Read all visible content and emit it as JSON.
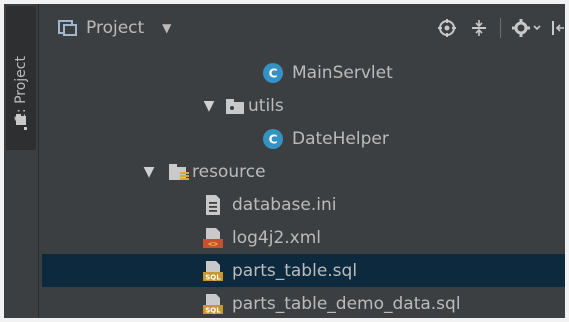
{
  "sidebar": {
    "tab_label": "1: Project"
  },
  "header": {
    "title": "Project",
    "actions": [
      "locate-icon",
      "collapse-all-icon",
      "settings-icon",
      "hide-icon"
    ]
  },
  "tree": {
    "items": [
      {
        "label": "MainServlet",
        "icon": "class-icon",
        "expanded": null,
        "selected": false
      },
      {
        "label": "utils",
        "icon": "package-folder-icon",
        "expanded": true,
        "selected": false
      },
      {
        "label": "DateHelper",
        "icon": "class-icon",
        "expanded": null,
        "selected": false
      },
      {
        "label": "resource",
        "icon": "resource-folder-icon",
        "expanded": true,
        "selected": false
      },
      {
        "label": "database.ini",
        "icon": "text-file-icon",
        "expanded": null,
        "selected": false
      },
      {
        "label": "log4j2.xml",
        "icon": "xml-file-icon",
        "expanded": null,
        "selected": false
      },
      {
        "label": "parts_table.sql",
        "icon": "sql-file-icon",
        "expanded": null,
        "selected": true
      },
      {
        "label": "parts_table_demo_data.sql",
        "icon": "sql-file-icon",
        "expanded": null,
        "selected": false
      }
    ]
  },
  "colors": {
    "background": "#3c3f41",
    "selection": "#0d293e",
    "text": "#bbbbbb",
    "class_icon": "#3592c4"
  }
}
